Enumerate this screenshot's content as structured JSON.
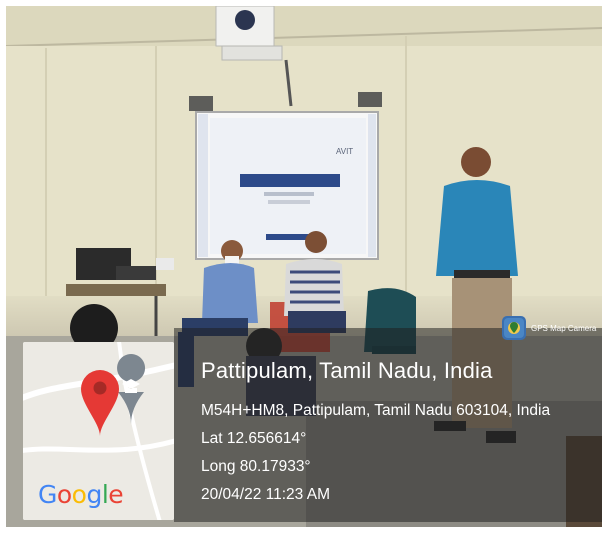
{
  "photo": {
    "subject": "classroom"
  },
  "stamp": {
    "place": "Pattipulam, Tamil Nadu, India",
    "address": "M54H+HM8, Pattipulam, Tamil Nadu 603104, India",
    "latitude": "Lat 12.656614°",
    "longitude": "Long 80.17933°",
    "datetime": "20/04/22 11:23 AM",
    "app_badge": "GPS Map Camera",
    "map_provider": "Google"
  },
  "screen": {
    "heading": "AVIT"
  },
  "icons": [
    "location-pin-icon",
    "institution-pin-icon",
    "gps-map-camera-icon"
  ],
  "colors": {
    "pin_red": "#e53935",
    "pin_gray": "#7d8790",
    "google_blue": "#4285f4",
    "google_red": "#ea4335",
    "google_yellow": "#fbbc05",
    "google_green": "#34a853"
  }
}
